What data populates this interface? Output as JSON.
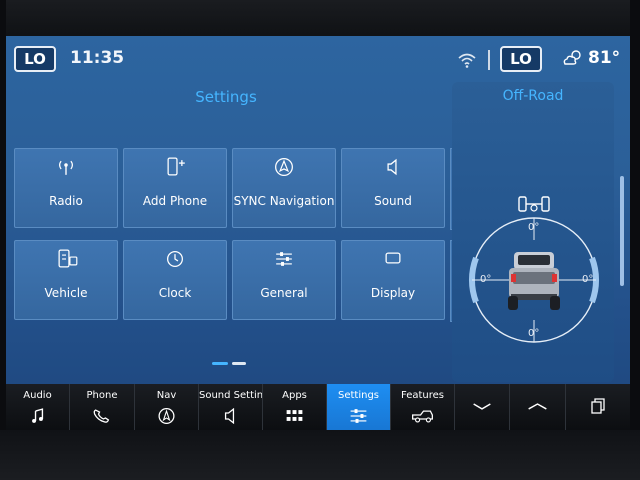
{
  "status": {
    "lo_left": "LO",
    "time": "11:35",
    "lo_right": "LO",
    "temperature": "81°"
  },
  "settings": {
    "title": "Settings",
    "tiles": [
      {
        "label": "Radio",
        "icon": "radio-icon"
      },
      {
        "label": "Add Phone",
        "icon": "add-phone-icon"
      },
      {
        "label": "SYNC Navigation",
        "icon": "navigation-icon"
      },
      {
        "label": "Sound",
        "icon": "speaker-icon"
      },
      {
        "label": "Vehicle",
        "icon": "vehicle-icon"
      },
      {
        "label": "Clock",
        "icon": "clock-icon"
      },
      {
        "label": "General",
        "icon": "sliders-icon"
      },
      {
        "label": "Display",
        "icon": "display-icon"
      }
    ]
  },
  "offroad": {
    "title": "Off-Road",
    "angle_top": "0°",
    "angle_left": "0°",
    "angle_right": "0°",
    "angle_bottom": "0°"
  },
  "navbar": {
    "items": [
      {
        "label": "Audio",
        "icon": "music-note-icon"
      },
      {
        "label": "Phone",
        "icon": "phone-icon"
      },
      {
        "label": "Nav",
        "icon": "navigation-icon"
      },
      {
        "label": "Sound Settings",
        "icon": "speaker-icon"
      },
      {
        "label": "Apps",
        "icon": "apps-grid-icon"
      },
      {
        "label": "Settings",
        "icon": "sliders-icon",
        "active": true
      },
      {
        "label": "Features",
        "icon": "truck-icon"
      }
    ]
  },
  "colors": {
    "accent": "#45b5ff",
    "active_tab": "#1e8ef2",
    "screen_bg": "#2b5f98"
  }
}
